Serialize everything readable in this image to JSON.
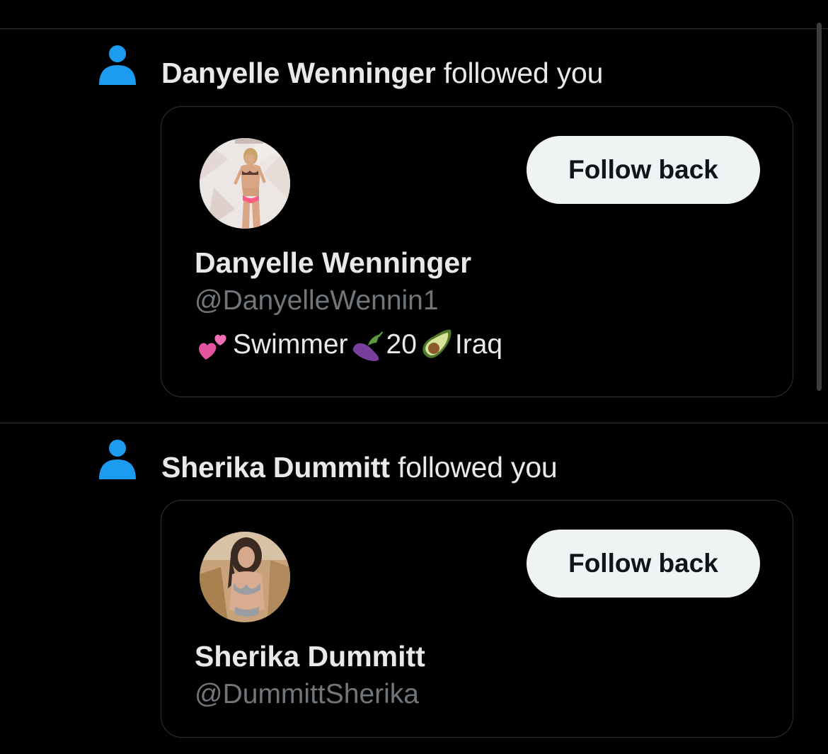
{
  "colors": {
    "background": "#000000",
    "accent_icon": "#1d9bf0",
    "divider": "#2f3336",
    "button_bg": "#eff3f4",
    "secondary_text": "#71767b"
  },
  "notifications": [
    {
      "icon": "person-icon",
      "actor_name": "Danyelle Wenninger",
      "action_text": " followed you",
      "card": {
        "display_name": "Danyelle Wenninger",
        "handle": "@DanyelleWennin1",
        "follow_button_label": "Follow back",
        "bio": [
          {
            "type": "emoji",
            "icon": "two-hearts-icon"
          },
          {
            "type": "text",
            "value": "Swimmer"
          },
          {
            "type": "emoji",
            "icon": "eggplant-icon"
          },
          {
            "type": "text",
            "value": "20"
          },
          {
            "type": "emoji",
            "icon": "avocado-icon"
          },
          {
            "type": "text",
            "value": "Iraq"
          }
        ]
      }
    },
    {
      "icon": "person-icon",
      "actor_name": "Sherika Dummitt",
      "action_text": " followed you",
      "card": {
        "display_name": "Sherika Dummitt",
        "handle": "@DummittSherika",
        "follow_button_label": "Follow back"
      }
    }
  ]
}
